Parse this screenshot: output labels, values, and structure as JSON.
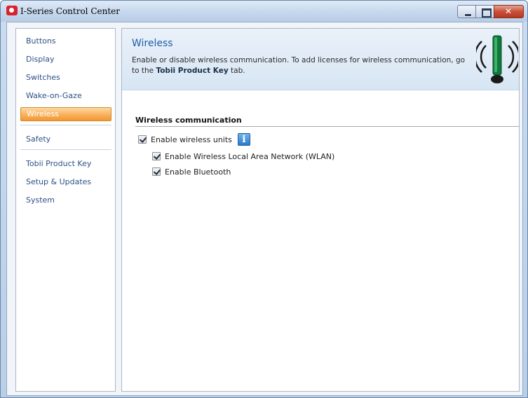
{
  "window": {
    "title": "I-Series Control Center",
    "controls": [
      "minimize",
      "maximize",
      "close"
    ]
  },
  "sidebar": {
    "items": [
      {
        "label": "Buttons",
        "active": false
      },
      {
        "label": "Display",
        "active": false
      },
      {
        "label": "Switches",
        "active": false
      },
      {
        "label": "Wake-on-Gaze",
        "active": false
      },
      {
        "label": "Wireless",
        "active": true
      },
      {
        "label": "Safety",
        "active": false
      },
      {
        "label": "Tobii Product Key",
        "active": false
      },
      {
        "label": "Setup & Updates",
        "active": false
      },
      {
        "label": "System",
        "active": false
      }
    ]
  },
  "banner": {
    "title": "Wireless",
    "description_pre": "Enable or disable wireless communication. To add licenses for wireless communication, go to the ",
    "description_link": "Tobii Product Key",
    "description_post": " tab.",
    "icon": "wireless-antenna-icon"
  },
  "section": {
    "heading": "Wireless communication",
    "checkboxes": [
      {
        "label": "Enable wireless units",
        "checked": true
      },
      {
        "label": "Enable Wireless Local Area Network (WLAN)",
        "checked": true
      },
      {
        "label": "Enable Bluetooth",
        "checked": true
      }
    ],
    "info_icon": "info-icon"
  },
  "colors": {
    "accent_active": "#f9b463",
    "title_blue": "#1d5ea8",
    "nav_text": "#2b5287",
    "antenna_green": "#0e7a3a"
  }
}
